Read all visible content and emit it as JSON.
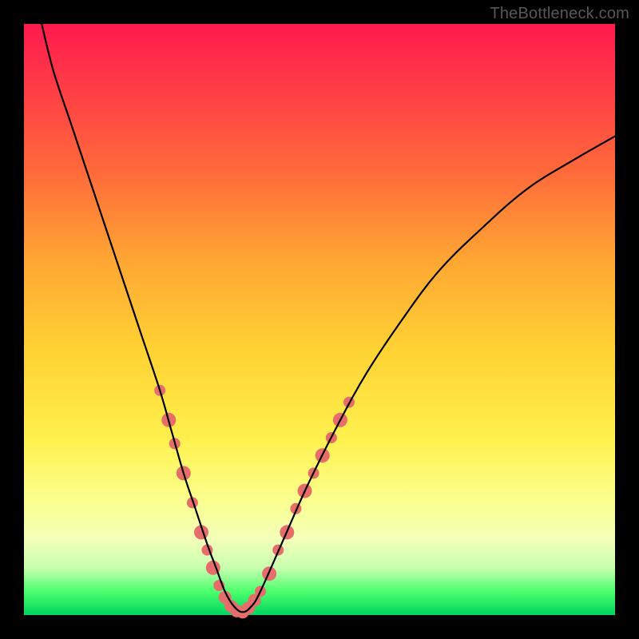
{
  "watermark": "TheBottleneck.com",
  "chart_data": {
    "type": "line",
    "title": "",
    "xlabel": "",
    "ylabel": "",
    "xlim": [
      0,
      100
    ],
    "ylim": [
      0,
      100
    ],
    "series": [
      {
        "name": "bottleneck-curve",
        "x": [
          3,
          5,
          8,
          11,
          14,
          17,
          20,
          23,
          25,
          27,
          29,
          31,
          32.5,
          34,
          35.5,
          37,
          38.5,
          40,
          44,
          48,
          53,
          58,
          64,
          70,
          77,
          85,
          93,
          100
        ],
        "y": [
          100,
          92,
          83,
          74,
          65,
          56,
          47,
          38,
          31,
          24,
          18,
          12,
          8,
          4,
          1.5,
          0.5,
          1.5,
          4,
          13,
          22,
          32,
          41,
          50,
          58,
          65,
          72,
          77,
          81
        ]
      }
    ],
    "markers": {
      "name": "highlighted-points",
      "color": "#e76d6d",
      "points": [
        {
          "x": 23.0,
          "y": 38,
          "r": 7
        },
        {
          "x": 24.5,
          "y": 33,
          "r": 9
        },
        {
          "x": 25.5,
          "y": 29,
          "r": 7
        },
        {
          "x": 27.0,
          "y": 24,
          "r": 9
        },
        {
          "x": 28.5,
          "y": 19,
          "r": 7
        },
        {
          "x": 30.0,
          "y": 14,
          "r": 9
        },
        {
          "x": 31.0,
          "y": 11,
          "r": 7
        },
        {
          "x": 32.0,
          "y": 8,
          "r": 9
        },
        {
          "x": 33.0,
          "y": 5,
          "r": 7
        },
        {
          "x": 34.0,
          "y": 3,
          "r": 8
        },
        {
          "x": 35.0,
          "y": 1.5,
          "r": 8
        },
        {
          "x": 36.0,
          "y": 0.7,
          "r": 8
        },
        {
          "x": 37.0,
          "y": 0.5,
          "r": 8
        },
        {
          "x": 38.0,
          "y": 1.2,
          "r": 8
        },
        {
          "x": 39.0,
          "y": 2.5,
          "r": 8
        },
        {
          "x": 40.0,
          "y": 4,
          "r": 7
        },
        {
          "x": 41.5,
          "y": 7,
          "r": 9
        },
        {
          "x": 43.0,
          "y": 11,
          "r": 7
        },
        {
          "x": 44.5,
          "y": 14,
          "r": 9
        },
        {
          "x": 46.0,
          "y": 18,
          "r": 7
        },
        {
          "x": 47.5,
          "y": 21,
          "r": 9
        },
        {
          "x": 49.0,
          "y": 24,
          "r": 7
        },
        {
          "x": 50.5,
          "y": 27,
          "r": 9
        },
        {
          "x": 52.0,
          "y": 30,
          "r": 7
        },
        {
          "x": 53.5,
          "y": 33,
          "r": 9
        },
        {
          "x": 55.0,
          "y": 36,
          "r": 7
        }
      ]
    }
  }
}
